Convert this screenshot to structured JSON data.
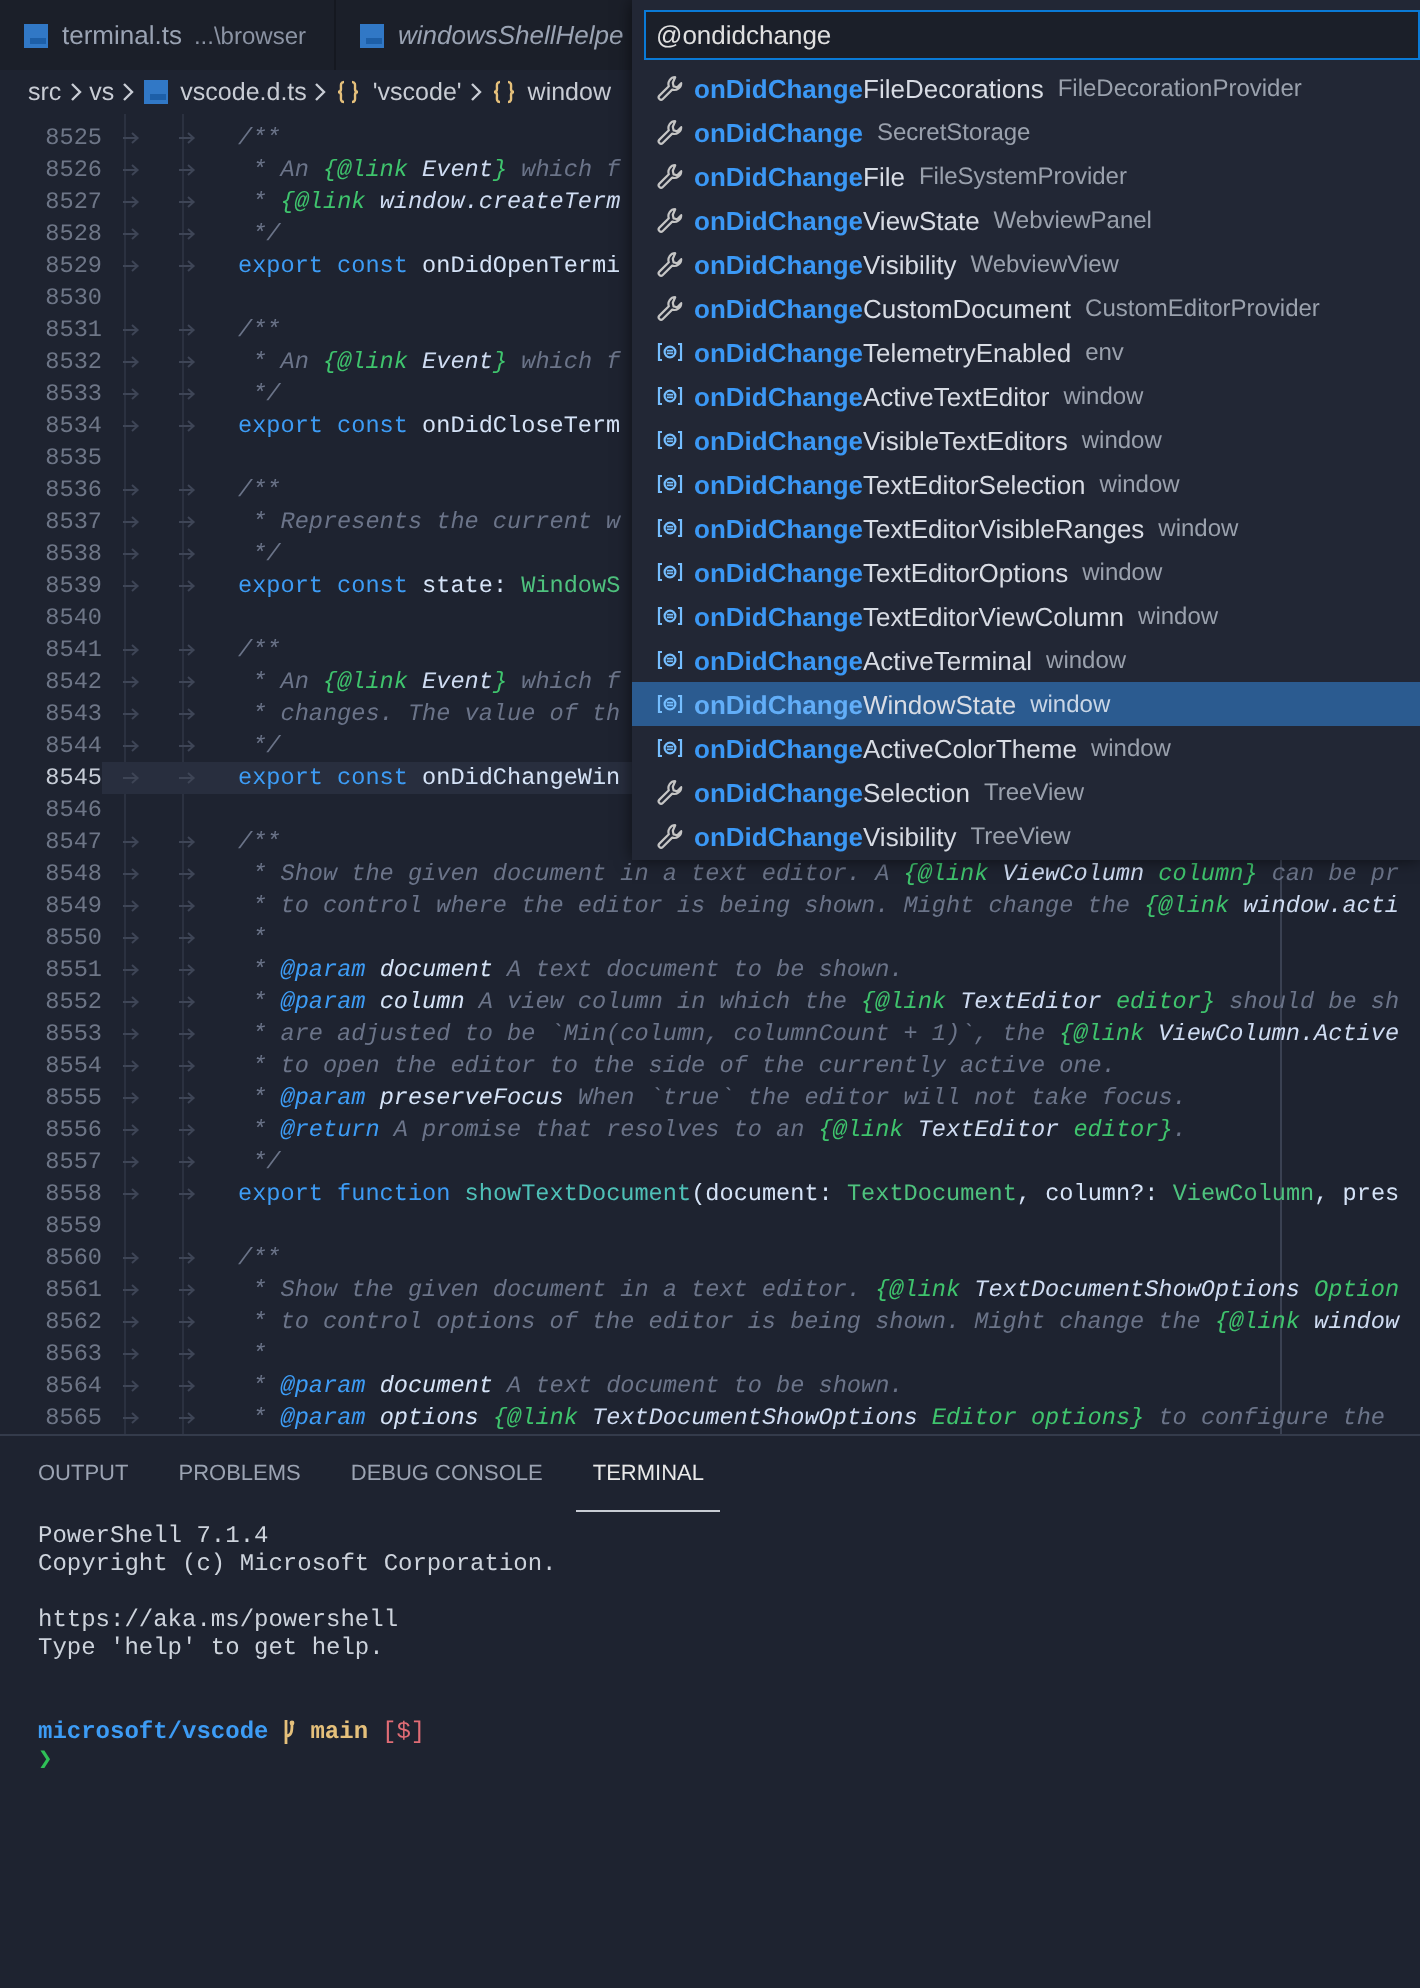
{
  "editor_tabs": [
    {
      "label": "terminal.ts",
      "description": "...\\browser",
      "preview": false,
      "selected": false
    },
    {
      "label": "windowsShellHelpe",
      "preview": true,
      "selected": false
    }
  ],
  "breadcrumb": [
    {
      "kind": "folder",
      "label": "src"
    },
    {
      "kind": "folder",
      "label": "vs"
    },
    {
      "kind": "file",
      "label": "vscode.d.ts"
    },
    {
      "kind": "namespace",
      "label": "'vscode'"
    },
    {
      "kind": "namespace",
      "label": "window"
    }
  ],
  "editor": {
    "lines": [
      {
        "number": "8525",
        "current": false,
        "tokens": [
          {
            "kind": "comment",
            "text": "/**"
          }
        ]
      },
      {
        "number": "8526",
        "current": false,
        "tokens": [
          {
            "kind": "comment",
            "text": " * An "
          },
          {
            "kind": "link",
            "text": "{@link"
          },
          {
            "kind": "ref",
            "text": " Event"
          },
          {
            "kind": "link",
            "text": "}"
          },
          {
            "kind": "comment",
            "text": " which f"
          }
        ]
      },
      {
        "number": "8527",
        "current": false,
        "tokens": [
          {
            "kind": "comment",
            "text": " * "
          },
          {
            "kind": "link",
            "text": "{@link"
          },
          {
            "kind": "ref",
            "text": " window.createTerm"
          }
        ]
      },
      {
        "number": "8528",
        "current": false,
        "tokens": [
          {
            "kind": "comment",
            "text": " */"
          }
        ]
      },
      {
        "number": "8529",
        "current": false,
        "tokens": [
          {
            "kind": "keyword",
            "text": "export const "
          },
          {
            "kind": "ident",
            "text": "onDidOpenTermi"
          }
        ]
      },
      {
        "number": "8530",
        "current": false
      },
      {
        "number": "8531",
        "current": false,
        "tokens": [
          {
            "kind": "comment",
            "text": "/**"
          }
        ]
      },
      {
        "number": "8532",
        "current": false,
        "tokens": [
          {
            "kind": "comment",
            "text": " * An "
          },
          {
            "kind": "link",
            "text": "{@link"
          },
          {
            "kind": "ref",
            "text": " Event"
          },
          {
            "kind": "link",
            "text": "}"
          },
          {
            "kind": "comment",
            "text": " which f"
          }
        ]
      },
      {
        "number": "8533",
        "current": false,
        "tokens": [
          {
            "kind": "comment",
            "text": " */"
          }
        ]
      },
      {
        "number": "8534",
        "current": false,
        "tokens": [
          {
            "kind": "keyword",
            "text": "export const "
          },
          {
            "kind": "ident",
            "text": "onDidCloseTerm"
          }
        ]
      },
      {
        "number": "8535",
        "current": false
      },
      {
        "number": "8536",
        "current": false,
        "tokens": [
          {
            "kind": "comment",
            "text": "/**"
          }
        ]
      },
      {
        "number": "8537",
        "current": false,
        "tokens": [
          {
            "kind": "comment",
            "text": " * Represents the current w"
          }
        ]
      },
      {
        "number": "8538",
        "current": false,
        "tokens": [
          {
            "kind": "comment",
            "text": " */"
          }
        ]
      },
      {
        "number": "8539",
        "current": false,
        "tokens": [
          {
            "kind": "keyword",
            "text": "export const "
          },
          {
            "kind": "ident",
            "text": "state"
          },
          {
            "kind": "punct",
            "text": ": "
          },
          {
            "kind": "type",
            "text": "WindowS"
          }
        ]
      },
      {
        "number": "8540",
        "current": false
      },
      {
        "number": "8541",
        "current": false,
        "tokens": [
          {
            "kind": "comment",
            "text": "/**"
          }
        ]
      },
      {
        "number": "8542",
        "current": false,
        "tokens": [
          {
            "kind": "comment",
            "text": " * An "
          },
          {
            "kind": "link",
            "text": "{@link"
          },
          {
            "kind": "ref",
            "text": " Event"
          },
          {
            "kind": "link",
            "text": "}"
          },
          {
            "kind": "comment",
            "text": " which f"
          }
        ]
      },
      {
        "number": "8543",
        "current": false,
        "tokens": [
          {
            "kind": "comment",
            "text": " * changes. The value of th"
          }
        ]
      },
      {
        "number": "8544",
        "current": false,
        "tokens": [
          {
            "kind": "comment",
            "text": " */"
          }
        ]
      },
      {
        "number": "8545",
        "current": true,
        "tokens": [
          {
            "kind": "keyword",
            "text": "export const "
          },
          {
            "kind": "ident",
            "text": "onDidChangeWin"
          }
        ]
      },
      {
        "number": "8546",
        "current": false
      },
      {
        "number": "8547",
        "current": false,
        "tokens": [
          {
            "kind": "comment",
            "text": "/**"
          }
        ]
      },
      {
        "number": "8548",
        "current": false,
        "tokens": [
          {
            "kind": "comment",
            "text": " * Show the given document in a text editor. A "
          },
          {
            "kind": "link",
            "text": "{@link"
          },
          {
            "kind": "ref",
            "text": " ViewColumn"
          },
          {
            "kind": "link",
            "text": " column}"
          },
          {
            "kind": "comment",
            "text": " can be pr"
          }
        ]
      },
      {
        "number": "8549",
        "current": false,
        "tokens": [
          {
            "kind": "comment",
            "text": " * to control where the editor is being shown. Might change the "
          },
          {
            "kind": "link",
            "text": "{@link"
          },
          {
            "kind": "ref",
            "text": " window.acti"
          }
        ]
      },
      {
        "number": "8550",
        "current": false,
        "tokens": [
          {
            "kind": "comment",
            "text": " *"
          }
        ]
      },
      {
        "number": "8551",
        "current": false,
        "tokens": [
          {
            "kind": "comment",
            "text": " * "
          },
          {
            "kind": "tag",
            "text": "@param"
          },
          {
            "kind": "param",
            "text": " document"
          },
          {
            "kind": "comment",
            "text": " A text document to be shown."
          }
        ]
      },
      {
        "number": "8552",
        "current": false,
        "tokens": [
          {
            "kind": "comment",
            "text": " * "
          },
          {
            "kind": "tag",
            "text": "@param"
          },
          {
            "kind": "param",
            "text": " column"
          },
          {
            "kind": "comment",
            "text": " A view column in which the "
          },
          {
            "kind": "link",
            "text": "{@link"
          },
          {
            "kind": "ref",
            "text": " TextEditor"
          },
          {
            "kind": "link",
            "text": " editor}"
          },
          {
            "kind": "comment",
            "text": " should be sh"
          }
        ]
      },
      {
        "number": "8553",
        "current": false,
        "tokens": [
          {
            "kind": "comment",
            "text": " * are adjusted to be `Min(column, columnCount + 1)`, the "
          },
          {
            "kind": "link",
            "text": "{@link"
          },
          {
            "kind": "ref",
            "text": " ViewColumn.Active"
          }
        ]
      },
      {
        "number": "8554",
        "current": false,
        "tokens": [
          {
            "kind": "comment",
            "text": " * to open the editor to the side of the currently active one."
          }
        ]
      },
      {
        "number": "8555",
        "current": false,
        "tokens": [
          {
            "kind": "comment",
            "text": " * "
          },
          {
            "kind": "tag",
            "text": "@param"
          },
          {
            "kind": "param",
            "text": " preserveFocus"
          },
          {
            "kind": "comment",
            "text": " When `true` the editor will not take focus."
          }
        ]
      },
      {
        "number": "8556",
        "current": false,
        "tokens": [
          {
            "kind": "comment",
            "text": " * "
          },
          {
            "kind": "tag",
            "text": "@return"
          },
          {
            "kind": "comment",
            "text": " A promise that resolves to an "
          },
          {
            "kind": "link",
            "text": "{@link"
          },
          {
            "kind": "ref",
            "text": " TextEditor"
          },
          {
            "kind": "link",
            "text": " editor}"
          },
          {
            "kind": "comment",
            "text": "."
          }
        ]
      },
      {
        "number": "8557",
        "current": false,
        "tokens": [
          {
            "kind": "comment",
            "text": " */"
          }
        ]
      },
      {
        "number": "8558",
        "current": false,
        "tokens": [
          {
            "kind": "keyword",
            "text": "export function "
          },
          {
            "kind": "func",
            "text": "showTextDocument"
          },
          {
            "kind": "punct",
            "text": "("
          },
          {
            "kind": "ident",
            "text": "document"
          },
          {
            "kind": "punct",
            "text": ": "
          },
          {
            "kind": "type",
            "text": "TextDocument"
          },
          {
            "kind": "punct",
            "text": ", "
          },
          {
            "kind": "ident",
            "text": "column"
          },
          {
            "kind": "punct",
            "text": "?: "
          },
          {
            "kind": "type",
            "text": "ViewColumn"
          },
          {
            "kind": "punct",
            "text": ", "
          },
          {
            "kind": "ident",
            "text": "pres"
          }
        ]
      },
      {
        "number": "8559",
        "current": false
      },
      {
        "number": "8560",
        "current": false,
        "tokens": [
          {
            "kind": "comment",
            "text": "/**"
          }
        ]
      },
      {
        "number": "8561",
        "current": false,
        "tokens": [
          {
            "kind": "comment",
            "text": " * Show the given document in a text editor. "
          },
          {
            "kind": "link",
            "text": "{@link"
          },
          {
            "kind": "ref",
            "text": " TextDocumentShowOptions"
          },
          {
            "kind": "link",
            "text": " Option"
          }
        ]
      },
      {
        "number": "8562",
        "current": false,
        "tokens": [
          {
            "kind": "comment",
            "text": " * to control options of the editor is being shown. Might change the "
          },
          {
            "kind": "link",
            "text": "{@link"
          },
          {
            "kind": "ref",
            "text": " window"
          }
        ]
      },
      {
        "number": "8563",
        "current": false,
        "tokens": [
          {
            "kind": "comment",
            "text": " *"
          }
        ]
      },
      {
        "number": "8564",
        "current": false,
        "tokens": [
          {
            "kind": "comment",
            "text": " * "
          },
          {
            "kind": "tag",
            "text": "@param"
          },
          {
            "kind": "param",
            "text": " document"
          },
          {
            "kind": "comment",
            "text": " A text document to be shown."
          }
        ]
      },
      {
        "number": "8565",
        "current": false,
        "tokens": [
          {
            "kind": "comment",
            "text": " * "
          },
          {
            "kind": "tag",
            "text": "@param"
          },
          {
            "kind": "param",
            "text": " options"
          },
          {
            "kind": "link",
            "text": " {@link"
          },
          {
            "kind": "ref",
            "text": " TextDocumentShowOptions"
          },
          {
            "kind": "link",
            "text": " Editor options}"
          },
          {
            "kind": "comment",
            "text": " to configure the"
          }
        ]
      }
    ]
  },
  "quick_open": {
    "value": "@ondidchange",
    "items": [
      {
        "kind": "method",
        "match": "onDidChange",
        "rest": "FileDecorations",
        "detail": "FileDecorationProvider",
        "selected": false
      },
      {
        "kind": "method",
        "match": "onDidChange",
        "detail": "SecretStorage",
        "selected": false
      },
      {
        "kind": "method",
        "match": "onDidChange",
        "rest": "File",
        "detail": "FileSystemProvider",
        "selected": false
      },
      {
        "kind": "method",
        "match": "onDidChange",
        "rest": "ViewState",
        "detail": "WebviewPanel",
        "selected": false
      },
      {
        "kind": "method",
        "match": "onDidChange",
        "rest": "Visibility",
        "detail": "WebviewView",
        "selected": false
      },
      {
        "kind": "method",
        "match": "onDidChange",
        "rest": "CustomDocument",
        "detail": "CustomEditorProvider",
        "selected": false
      },
      {
        "kind": "field",
        "match": "onDidChange",
        "rest": "TelemetryEnabled",
        "detail": "env",
        "selected": false
      },
      {
        "kind": "field",
        "match": "onDidChange",
        "rest": "ActiveTextEditor",
        "detail": "window",
        "selected": false
      },
      {
        "kind": "field",
        "match": "onDidChange",
        "rest": "VisibleTextEditors",
        "detail": "window",
        "selected": false
      },
      {
        "kind": "field",
        "match": "onDidChange",
        "rest": "TextEditorSelection",
        "detail": "window",
        "selected": false
      },
      {
        "kind": "field",
        "match": "onDidChange",
        "rest": "TextEditorVisibleRanges",
        "detail": "window",
        "selected": false
      },
      {
        "kind": "field",
        "match": "onDidChange",
        "rest": "TextEditorOptions",
        "detail": "window",
        "selected": false
      },
      {
        "kind": "field",
        "match": "onDidChange",
        "rest": "TextEditorViewColumn",
        "detail": "window",
        "selected": false
      },
      {
        "kind": "field",
        "match": "onDidChange",
        "rest": "ActiveTerminal",
        "detail": "window",
        "selected": false
      },
      {
        "kind": "field",
        "match": "onDidChange",
        "rest": "WindowState",
        "detail": "window",
        "selected": true
      },
      {
        "kind": "field",
        "match": "onDidChange",
        "rest": "ActiveColorTheme",
        "detail": "window",
        "selected": false
      },
      {
        "kind": "method",
        "match": "onDidChange",
        "rest": "Selection",
        "detail": "TreeView",
        "selected": false
      },
      {
        "kind": "method",
        "match": "onDidChange",
        "rest": "Visibility",
        "detail": "TreeView",
        "selected": false
      }
    ]
  },
  "panel": {
    "tabs": [
      {
        "label": "OUTPUT",
        "selected": false
      },
      {
        "label": "PROBLEMS",
        "selected": false
      },
      {
        "label": "DEBUG CONSOLE",
        "selected": false
      },
      {
        "label": "TERMINAL",
        "selected": true
      }
    ],
    "terminal": {
      "blocks": [
        [
          "PowerShell 7.1.4",
          "Copyright (c) Microsoft Corporation."
        ],
        [
          "https://aka.ms/powershell",
          "Type 'help' to get help."
        ]
      ],
      "prompt": {
        "path": "microsoft/vscode",
        "branch": "main",
        "status": "[$]",
        "input_marker": "❯"
      }
    }
  }
}
